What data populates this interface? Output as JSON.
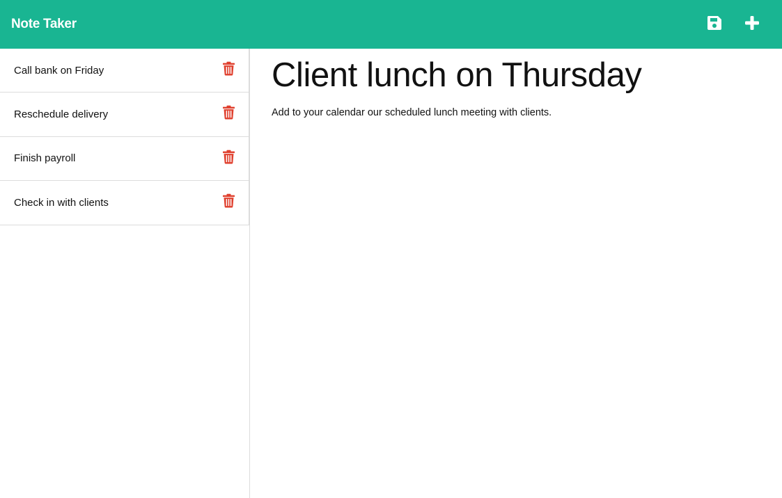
{
  "navbar": {
    "brand": "Note Taker",
    "actions": [
      {
        "icon": "save-icon"
      },
      {
        "icon": "plus-icon"
      }
    ],
    "background_color": "#19b592"
  },
  "sidebar": {
    "notes": [
      {
        "title": "Call bank on Friday",
        "delete_icon": "trash-icon"
      },
      {
        "title": "Reschedule delivery",
        "delete_icon": "trash-icon"
      },
      {
        "title": "Finish payroll",
        "delete_icon": "trash-icon"
      },
      {
        "title": "Check in with clients",
        "delete_icon": "trash-icon"
      }
    ],
    "delete_color": "#e0412f"
  },
  "main": {
    "title": "Client lunch on Thursday",
    "text": "Add to your calendar our scheduled lunch meeting with clients."
  }
}
